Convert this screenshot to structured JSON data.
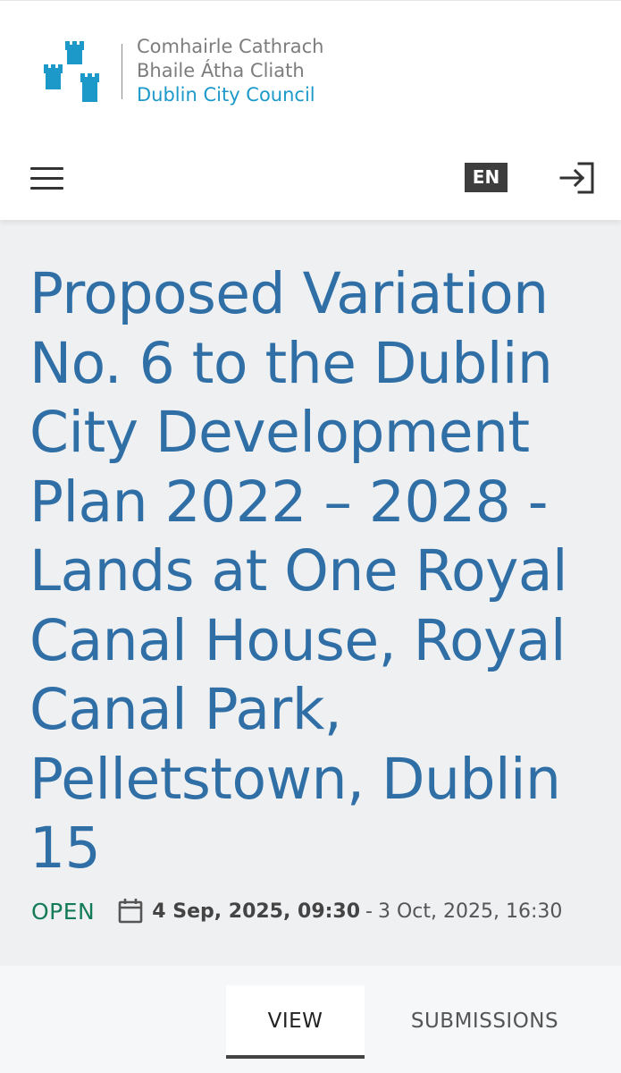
{
  "header": {
    "logo": {
      "line1": "Comhairle Cathrach",
      "line2": "Bhaile Átha Cliath",
      "line3": "Dublin City Council",
      "icon": "three-castles-icon",
      "color": "#1d99c9"
    },
    "menu_icon": "hamburger-menu-icon",
    "language": "EN",
    "login_icon": "sign-in-icon"
  },
  "consultation": {
    "title": "Proposed Variation No. 6 to the Dublin City Development Plan 2022 – 2028 - Lands at One Royal Canal House, Royal Canal Park, Pelletstown, Dublin 15",
    "status": "OPEN",
    "status_color": "#137c57",
    "date_start": "4 Sep, 2025, 09:30",
    "date_separator": "-",
    "date_end": "3 Oct, 2025, 16:30",
    "calendar_icon": "calendar-icon"
  },
  "tabs": [
    {
      "label": "VIEW",
      "active": true
    },
    {
      "label": "SUBMISSIONS",
      "active": false
    }
  ]
}
